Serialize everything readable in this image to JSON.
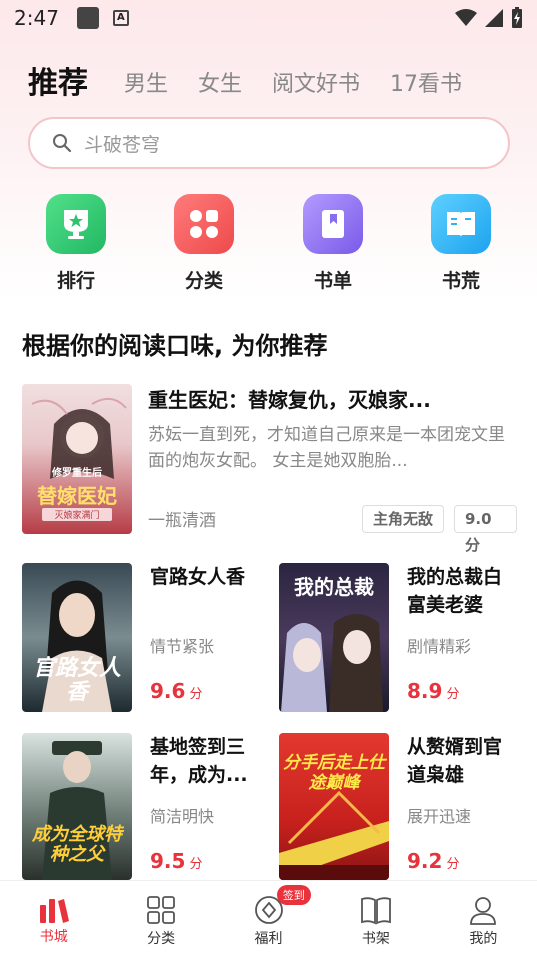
{
  "status_bar": {
    "time": "2:47"
  },
  "tabs": [
    {
      "label": "推荐",
      "active": true
    },
    {
      "label": "男生"
    },
    {
      "label": "女生"
    },
    {
      "label": "阅文好书"
    },
    {
      "label": "17看书"
    }
  ],
  "search": {
    "placeholder": "斗破苍穹"
  },
  "quick_links": [
    {
      "label": "排行",
      "icon": "trophy-icon",
      "color": "#2ecc71"
    },
    {
      "label": "分类",
      "icon": "category-icon",
      "color": "#f25a5a"
    },
    {
      "label": "书单",
      "icon": "booklist-icon",
      "color": "#8a6cf0"
    },
    {
      "label": "书荒",
      "icon": "book-icon",
      "color": "#2fb3f5"
    }
  ],
  "section": {
    "title": "根据你的阅读口味, 为你推荐"
  },
  "featured": {
    "title": "重生医妃：替嫁复仇，灭娘家...",
    "description": "苏妘一直到死，才知道自己原来是一本团宠文里面的炮灰女配。        女主是她双胞胎...",
    "author": "一瓶清酒",
    "tag": "主角无敌",
    "score": "9.0分",
    "cover_text": [
      "修罗重生后",
      "替嫁医妃",
      "灭娘家满门"
    ]
  },
  "books": [
    {
      "title": "官路女人香",
      "tag": "情节紧张",
      "score": "9.6",
      "unit": "分",
      "cover_text": "官路女人香"
    },
    {
      "title": "我的总裁白富美老婆",
      "tag": "剧情精彩",
      "score": "8.9",
      "unit": "分",
      "cover_text": "我的总裁"
    },
    {
      "title": "基地签到三年，成为...",
      "tag": "简洁明快",
      "score": "9.5",
      "unit": "分",
      "cover_text": "成为全球特种之父"
    },
    {
      "title": "从赘婿到官道枭雄",
      "tag": "展开迅速",
      "score": "9.2",
      "unit": "分",
      "cover_text": "分手后走上仕途巅峰"
    }
  ],
  "bottom_nav": [
    {
      "label": "书城",
      "icon": "bookstore-icon",
      "active": true
    },
    {
      "label": "分类",
      "icon": "grid-icon"
    },
    {
      "label": "福利",
      "icon": "coin-icon",
      "badge": "签到"
    },
    {
      "label": "书架",
      "icon": "bookshelf-icon"
    },
    {
      "label": "我的",
      "icon": "user-icon"
    }
  ],
  "colors": {
    "accent": "#e8323c",
    "search_border": "#f3c4c8"
  }
}
